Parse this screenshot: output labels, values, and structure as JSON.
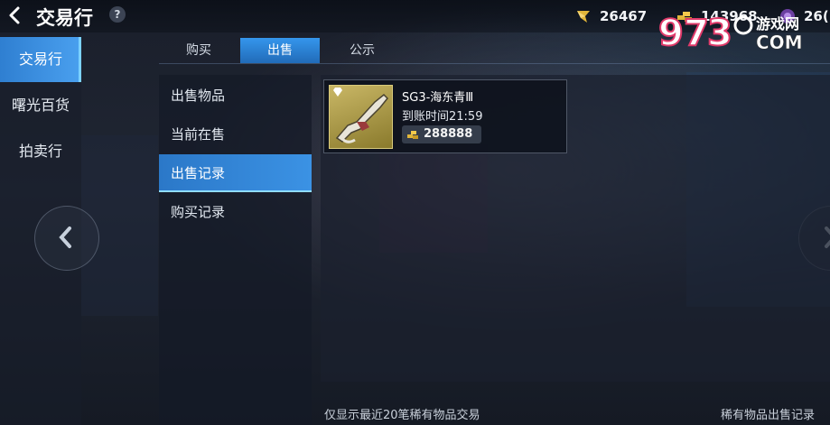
{
  "header": {
    "title": "交易行",
    "help_symbol": "?",
    "currencies": [
      {
        "icon": "crystal-icon",
        "value": "26467"
      },
      {
        "icon": "gold-icon",
        "value": "143968"
      },
      {
        "icon": "purple-coin-icon",
        "value": "26("
      }
    ]
  },
  "watermark": {
    "digits": "9",
    "text_top": "游戏网",
    "text_bottom": "COM"
  },
  "sidebar": {
    "items": [
      {
        "label": "交易行",
        "active": true
      },
      {
        "label": "曙光百货",
        "active": false
      },
      {
        "label": "拍卖行",
        "active": false
      }
    ]
  },
  "tabs": [
    {
      "label": "购买",
      "active": false
    },
    {
      "label": "出售",
      "active": true
    },
    {
      "label": "公示",
      "active": false
    }
  ],
  "submenu": [
    {
      "label": "出售物品",
      "active": false
    },
    {
      "label": "当前在售",
      "active": false
    },
    {
      "label": "出售记录",
      "active": true
    },
    {
      "label": "购买记录",
      "active": false
    }
  ],
  "record": {
    "name": "SG3-海东青Ⅲ",
    "arrival": "到账时间21:59",
    "price": "288888"
  },
  "footer": {
    "note": "仅显示最近20笔稀有物品交易",
    "link": "稀有物品出售记录"
  },
  "colors": {
    "accent": "#3596ec",
    "gold": "#e0b53a"
  }
}
